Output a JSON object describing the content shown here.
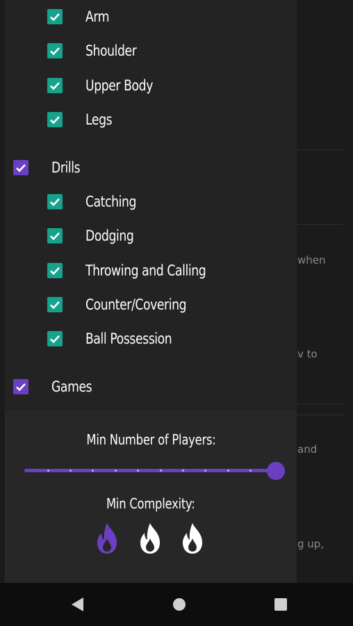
{
  "background_page": {
    "snippets": [
      "when",
      "v to",
      "and",
      "g up,"
    ]
  },
  "filters": {
    "sub_items_top": [
      {
        "label": "Arm",
        "checked": true
      },
      {
        "label": "Shoulder",
        "checked": true
      },
      {
        "label": "Upper Body",
        "checked": true
      },
      {
        "label": "Legs",
        "checked": true
      }
    ],
    "drills": {
      "label": "Drills",
      "checked": true,
      "items": [
        {
          "label": "Catching",
          "checked": true
        },
        {
          "label": "Dodging",
          "checked": true
        },
        {
          "label": "Throwing and Calling",
          "checked": true
        },
        {
          "label": "Counter/Covering",
          "checked": true
        },
        {
          "label": "Ball Possession",
          "checked": true
        }
      ]
    },
    "games": {
      "label": "Games",
      "checked": true
    }
  },
  "controls": {
    "min_players_label": "Min Number of Players:",
    "min_players_value_fraction": 1.0,
    "min_complexity_label": "Min Complexity:",
    "complexity_selected": 1,
    "complexity_max": 3
  },
  "colors": {
    "accent_purple": "#6b3fc2",
    "checkbox_teal": "#16a28d"
  },
  "icons": {
    "check": "check-icon",
    "complexity": "flame-icon",
    "nav_back": "back-triangle-icon",
    "nav_home": "home-circle-icon",
    "nav_recents": "recents-square-icon"
  }
}
